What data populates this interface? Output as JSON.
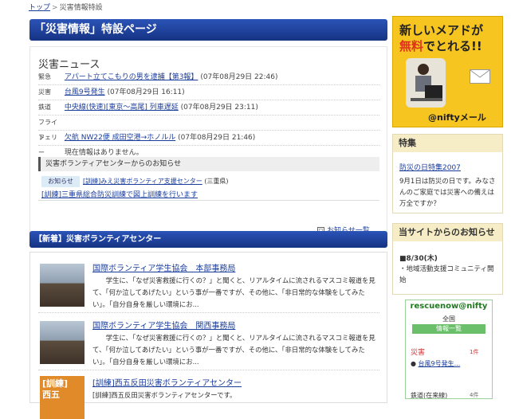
{
  "breadcrumb": {
    "home": "トップ",
    "current": "災害情報特設"
  },
  "page_title": "「災害情報」特設ページ",
  "news": {
    "heading": "災害ニュース",
    "rows": [
      {
        "category": "緊急",
        "link": "アパート立てこもりの男を逮捕【第3報】",
        "date": "(07年08月29日 22:46)"
      },
      {
        "category": "災害",
        "link": "台風9号発生",
        "date": "(07年08月29日 16:11)"
      },
      {
        "category": "鉄道",
        "link": "中央線(快速)[東京～高尾] 列車遅延",
        "date": "(07年08月29日 23:11)"
      },
      {
        "category": "フライト",
        "link": "欠航 NW22便 成田空港→ホノルル",
        "date": "(07年08月29日 21:46)"
      },
      {
        "category": "フェリー",
        "link": "",
        "date": "現在情報はありません。"
      }
    ]
  },
  "volunteer_center_notice": {
    "heading": "災害ボランティアセンターからのお知らせ",
    "tag": "お知らせ",
    "item1_link": "[訓練]みえ災害ボランティア支援センター",
    "item1_suffix": "(三重県)",
    "item2_link": "[訓練]三重県総合防災訓練で図上訓練を行います",
    "list_link": "お知らせ一覧",
    "list_icon": "□"
  },
  "volunteer_section": {
    "heading": "【新着】災害ボランティアセンター",
    "items": [
      {
        "title": "国際ボランティア学生協会　本部事務局",
        "desc": "学生に、「なぜ災害救援に行くの？」と聞くと、リアルタイムに流されるマスコミ報道を見て、「何か泣してあげたい」という事が一番ですが、その他に、「非日常的な体験をしてみたい」。「自分自身を厳しい環境にお..."
      },
      {
        "title": "国際ボランティア学生協会　関西事務局",
        "desc": "学生に、「なぜ災害救援に行くの？」と聞くと、リアルタイムに流されるマスコミ報道を見て、「何か泣してあげたい」という事が一番ですが、その他に、「非日常的な体験をしてみたい」。「自分自身を厳しい環境にお..."
      },
      {
        "title": "[訓練]西五反田災害ボランティアセンター",
        "desc": "[訓練]西五反田災害ボランティアセンターです。",
        "thumb_text": "[訓練]\n西五"
      }
    ]
  },
  "ad": {
    "line1": "新しいメアドが",
    "line2_free": "無料",
    "line2_rest": "でとれる!!",
    "brand": "@niftyメール"
  },
  "special": {
    "heading": "特集",
    "link": "防災の日特集2007",
    "desc": "9月1日は防災の日です。みなさんのご家庭では災害への備えは万全ですか？"
  },
  "site_info": {
    "heading": "当サイトからのお知らせ",
    "date": "■8/30(木)",
    "text": "・地域活動支援コミュニティ開始"
  },
  "rescue": {
    "logo": "rescuenow@nifty",
    "area": "全国",
    "list_label": "情報一覧",
    "disaster_label": "災害",
    "disaster_count": "1件",
    "disaster_item": "台風9号発生...",
    "rail_label": "鉄道(在来線)",
    "rail_count": "4件"
  }
}
